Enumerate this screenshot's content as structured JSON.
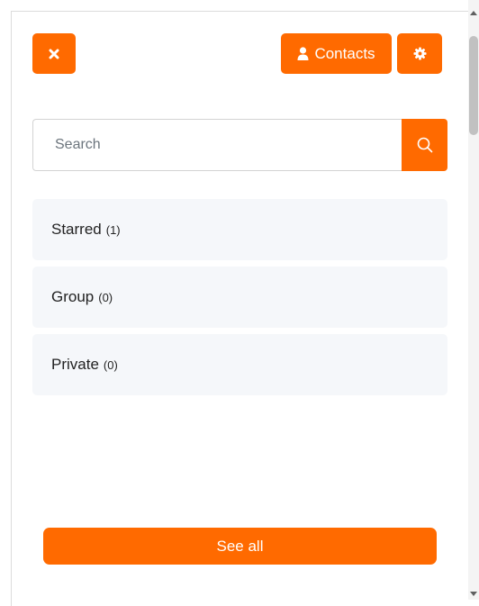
{
  "header": {
    "close_icon": "close-icon",
    "contacts_label": "Contacts",
    "contacts_icon": "user-icon",
    "settings_icon": "gear-icon"
  },
  "search": {
    "placeholder": "Search",
    "value": "",
    "icon": "search-icon"
  },
  "categories": [
    {
      "label": "Starred",
      "count": "(1)"
    },
    {
      "label": "Group",
      "count": "(0)"
    },
    {
      "label": "Private",
      "count": "(0)"
    }
  ],
  "footer": {
    "see_all_label": "See all"
  },
  "colors": {
    "accent": "#ff6a00",
    "item_bg": "#f5f7fa",
    "text": "#222222"
  }
}
